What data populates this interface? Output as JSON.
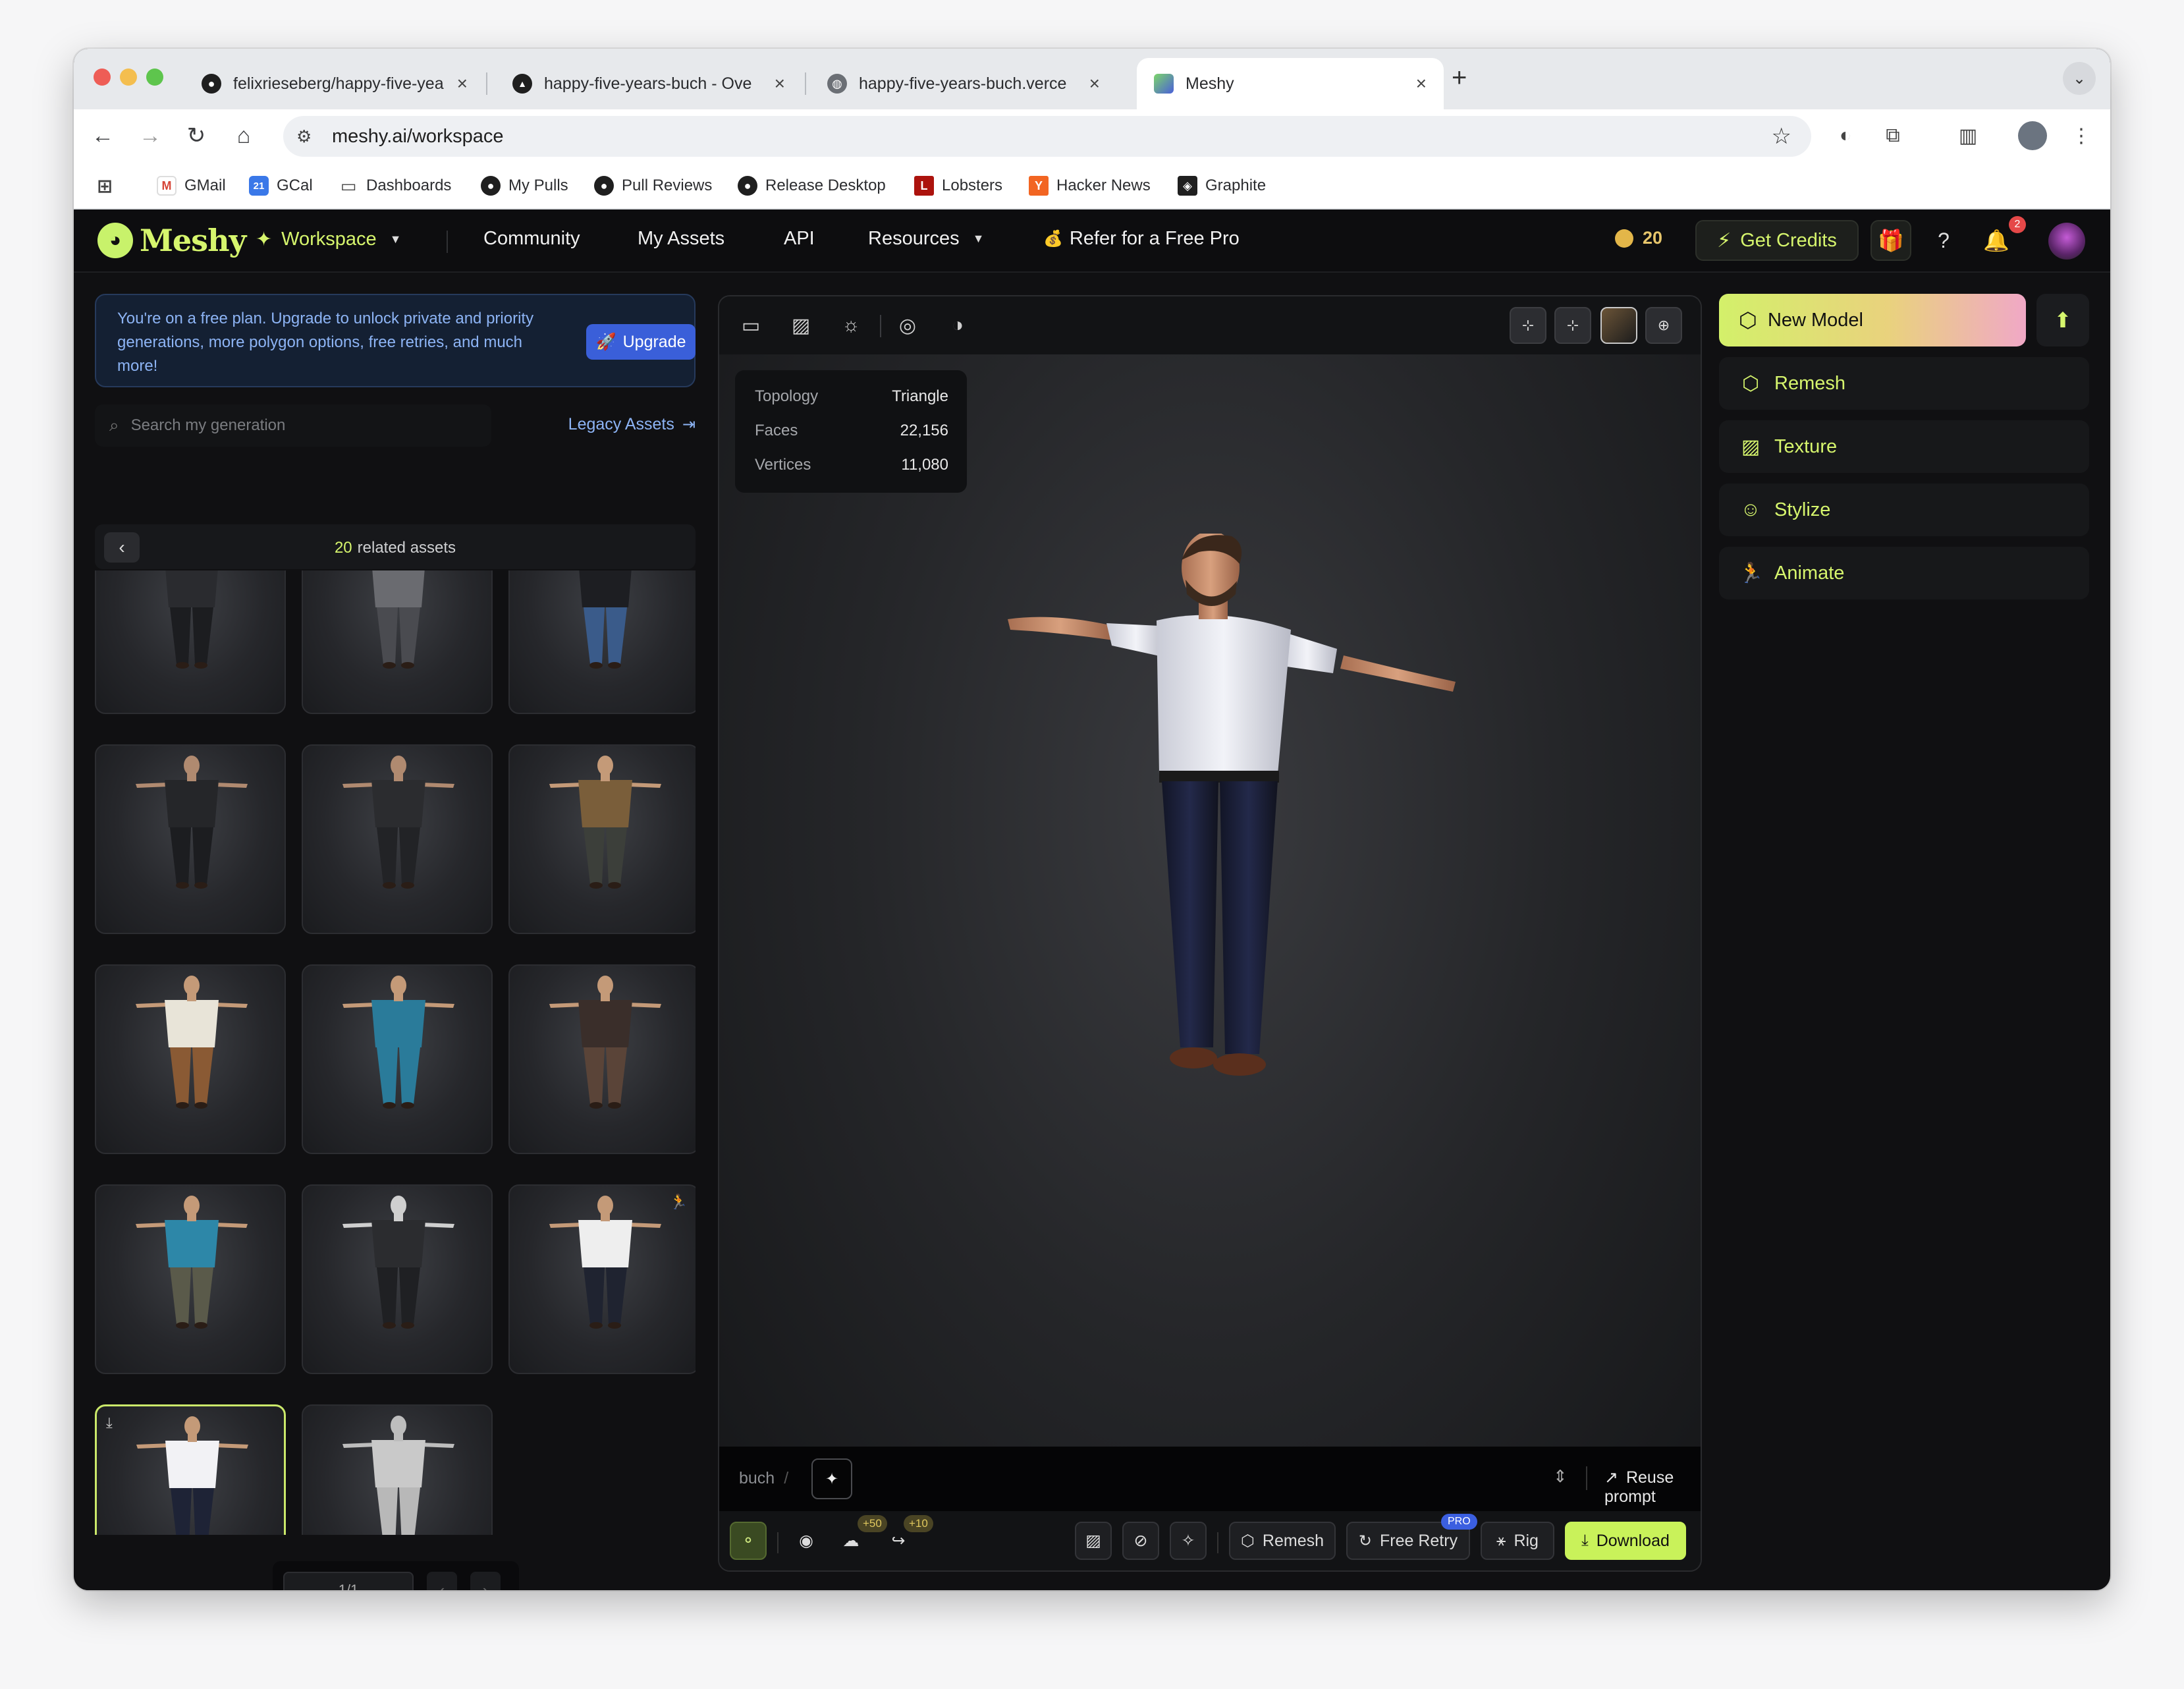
{
  "browser": {
    "tabs": [
      {
        "title": "felixrieseberg/happy-five-yea",
        "icon": "github-icon"
      },
      {
        "title": "happy-five-years-buch - Ove",
        "icon": "vercel-icon"
      },
      {
        "title": "happy-five-years-buch.verce",
        "icon": "globe-icon"
      },
      {
        "title": "Meshy",
        "icon": "meshy-icon",
        "active": true
      }
    ],
    "url": "meshy.ai/workspace",
    "bookmarks": [
      {
        "label": "GMail",
        "icon": "gmail-icon"
      },
      {
        "label": "GCal",
        "icon": "gcal-icon"
      },
      {
        "label": "Dashboards",
        "icon": "folder-icon"
      },
      {
        "label": "My Pulls",
        "icon": "github-icon"
      },
      {
        "label": "Pull Reviews",
        "icon": "github-icon"
      },
      {
        "label": "Release Desktop",
        "icon": "github-icon"
      },
      {
        "label": "Lobsters",
        "icon": "lobsters-icon"
      },
      {
        "label": "Hacker News",
        "icon": "hackernews-icon"
      },
      {
        "label": "Graphite",
        "icon": "graphite-icon"
      }
    ],
    "gcal_day": "21"
  },
  "nav": {
    "brand": "Meshy",
    "workspace": "Workspace",
    "community": "Community",
    "my_assets": "My Assets",
    "api": "API",
    "resources": "Resources",
    "refer": "Refer for a Free Pro",
    "credits": "20",
    "get_credits": "Get Credits",
    "notifications_count": "2"
  },
  "left": {
    "upgrade_text": "You're on a free plan. Upgrade to unlock private and priority generations, more polygon options, free retries, and much more!",
    "upgrade_label": "Upgrade",
    "search_placeholder": "Search my generation",
    "legacy_label": "Legacy Assets",
    "related_count": "20",
    "related_label": "related assets",
    "pagination": "1/1",
    "assets": [
      {
        "shirt": "#2a2b2f",
        "pants": "#1c1d20",
        "skin": "#b08a70"
      },
      {
        "shirt": "#6a6b70",
        "pants": "#4a4b50",
        "skin": "#b08a70"
      },
      {
        "shirt": "#1d1e22",
        "pants": "#3a5b8a",
        "skin": "#b08a70"
      },
      {
        "shirt": "#252629",
        "pants": "#1c1d20",
        "skin": "#b08a70"
      },
      {
        "shirt": "#2b2c2f",
        "pants": "#222326",
        "skin": "#b08a70"
      },
      {
        "shirt": "#7a5e3a",
        "pants": "#3c3f3a",
        "skin": "#c49a78"
      },
      {
        "shirt": "#e8e4d8",
        "pants": "#8a5a34",
        "skin": "#c49a78"
      },
      {
        "shirt": "#2a7b9a",
        "pants": "#2a7b9a",
        "skin": "#c49a78"
      },
      {
        "shirt": "#3a2e2a",
        "pants": "#5a4438",
        "skin": "#c49a78"
      },
      {
        "shirt": "#2d87a8",
        "pants": "#5a5a4a",
        "skin": "#c49a78"
      },
      {
        "shirt": "#2b2c2f",
        "pants": "#1f2023",
        "skin": "#cfcfcf"
      },
      {
        "shirt": "#eeeeee",
        "pants": "#1f2330",
        "skin": "#c49a78",
        "tag": "run-icon"
      },
      {
        "shirt": "#f2f2f5",
        "pants": "#1e2336",
        "skin": "#c49a78",
        "tag": "download-icon",
        "selected": true
      },
      {
        "shirt": "#c9c9c9",
        "pants": "#b8b8b8",
        "skin": "#bdbdbd"
      }
    ]
  },
  "viewport": {
    "stats": [
      {
        "label": "Topology",
        "value": "Triangle"
      },
      {
        "label": "Faces",
        "value": "22,156"
      },
      {
        "label": "Vertices",
        "value": "11,080"
      }
    ],
    "prompt_name": "buch",
    "reuse_prompt": "Reuse prompt",
    "bonus_upload": "+50",
    "bonus_share": "+10",
    "remesh": "Remesh",
    "free_retry": "Free Retry",
    "pro": "PRO",
    "rig": "Rig",
    "download": "Download"
  },
  "right": {
    "new_model": "New Model",
    "tools": [
      {
        "label": "Remesh",
        "icon": "remesh-icon"
      },
      {
        "label": "Texture",
        "icon": "texture-icon"
      },
      {
        "label": "Stylize",
        "icon": "stylize-icon"
      },
      {
        "label": "Animate",
        "icon": "animate-icon"
      }
    ]
  },
  "colors": {
    "accent": "#d6f56d",
    "upgrade_blue": "#3a5fd9",
    "panel_bg": "#101012"
  }
}
